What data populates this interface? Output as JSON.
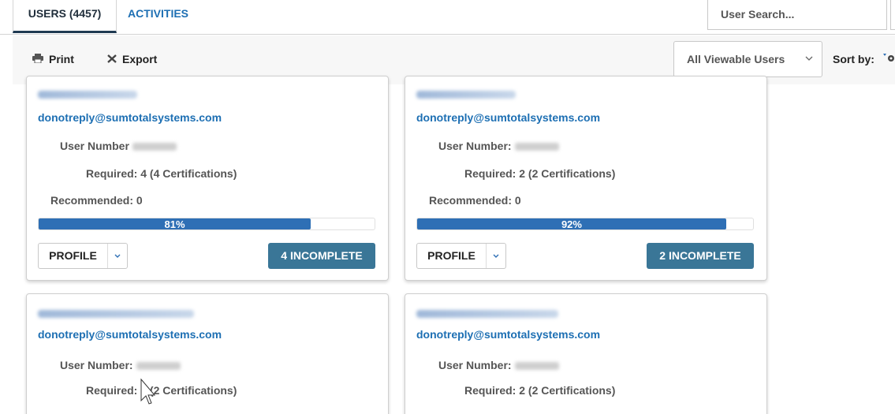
{
  "tabs": [
    {
      "label": "USERS (4457)",
      "active": true
    },
    {
      "label": "ACTIVITIES",
      "active": false
    }
  ],
  "search": {
    "placeholder": "User Search..."
  },
  "toolbar": {
    "print_label": "Print",
    "export_label": "Export",
    "filter_value": "All Viewable Users",
    "sort_label": "Sort by:"
  },
  "labels": {
    "email": "donotreply@sumtotalsystems.com",
    "profile": "PROFILE"
  },
  "cards": [
    {
      "user_number_label": "User Number",
      "required": "Required: 4 (4 Certifications)",
      "recommended": "Recommended: 0",
      "progress_label": "81%",
      "progress": 0.81,
      "incomplete_label": "4 INCOMPLETE"
    },
    {
      "user_number_label": "User Number:",
      "required": "Required: 2 (2 Certifications)",
      "recommended": "Recommended: 0",
      "progress_label": "92%",
      "progress": 0.92,
      "incomplete_label": "2 INCOMPLETE"
    },
    {
      "user_number_label": "User Number:",
      "required": "Required: 2 (2 Certifications)"
    },
    {
      "user_number_label": "User Number:",
      "required": "Required: 2 (2 Certifications)"
    }
  ],
  "colors": {
    "link": "#1d6fb3",
    "progress": "#2e6fb5",
    "incomplete_button": "#3a7697",
    "toolbar_bg": "#f7f7f7"
  },
  "icons": {
    "print": "printer-icon",
    "export": "excel-export-icon",
    "filter": "chevron-down-icon",
    "sort": "sort-direction-icon",
    "profile_menu": "caret-down-icon"
  }
}
